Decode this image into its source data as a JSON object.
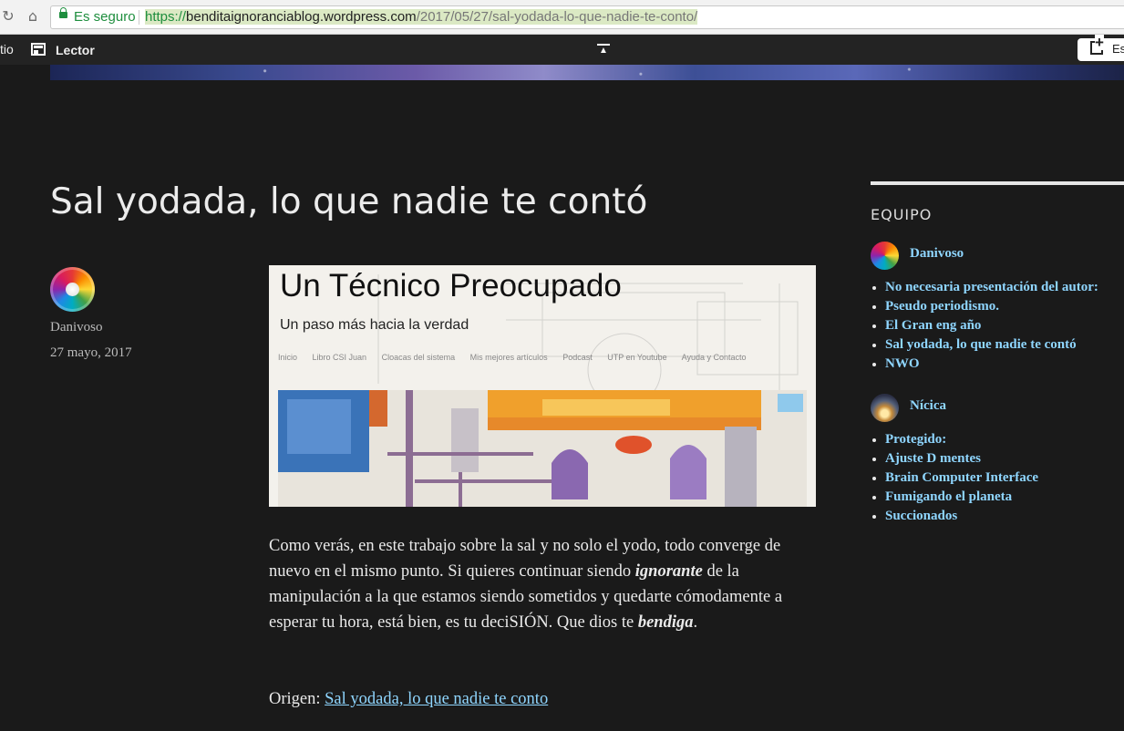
{
  "browser": {
    "secure_label": "Es seguro",
    "url_scheme": "https://",
    "url_host": "benditaignoranciablog.wordpress.com",
    "url_path": "/2017/05/27/sal-yodada-lo-que-nadie-te-conto/"
  },
  "admin_bar": {
    "left_cut_text": "tio",
    "reader_label": "Lector",
    "write_label": "Es"
  },
  "post": {
    "title": "Sal yodada, lo que nadie te contó",
    "author": "Danivoso",
    "date": "27 mayo, 2017",
    "banner": {
      "title": "Un Técnico Preocupado",
      "subtitle": "Un paso más hacia la verdad",
      "menu": [
        "Inicio",
        "Libro CSI Juan",
        "Cloacas del sistema",
        "Mis mejores artículos",
        "Podcast",
        "UTP en Youtube",
        "Ayuda y Contacto"
      ]
    },
    "body_1": "Como verás, en este trabajo sobre la sal y no solo el yodo, todo converge de nuevo en el mismo punto. Si quieres continuar siendo ",
    "body_em_1": "ignorante",
    "body_2": " de la manipulación a la que estamos siendo sometidos y quedarte cómodamente a esperar tu hora, está bien, es tu deciSIÓN. Que dios te ",
    "body_em_2": "bendiga",
    "body_3": ".",
    "origin_label": "Origen: ",
    "origin_link": "Sal yodada, lo que nadie te conto"
  },
  "sidebar": {
    "title": "EQUIPO",
    "members": [
      {
        "name": "Danivoso",
        "posts": [
          "No necesaria presentación del autor:",
          "Pseudo periodismo.",
          "El Gran eng año",
          "Sal yodada, lo que nadie te contó",
          "NWO"
        ]
      },
      {
        "name": "Nícica",
        "posts": [
          "Protegido:",
          "Ajuste D mentes",
          "Brain Computer Interface",
          "Fumigando el planeta",
          "Succionados"
        ]
      }
    ]
  },
  "colors": {
    "background": "#1a1a1a",
    "link": "#8fd6ff",
    "text": "#eaeaea"
  }
}
